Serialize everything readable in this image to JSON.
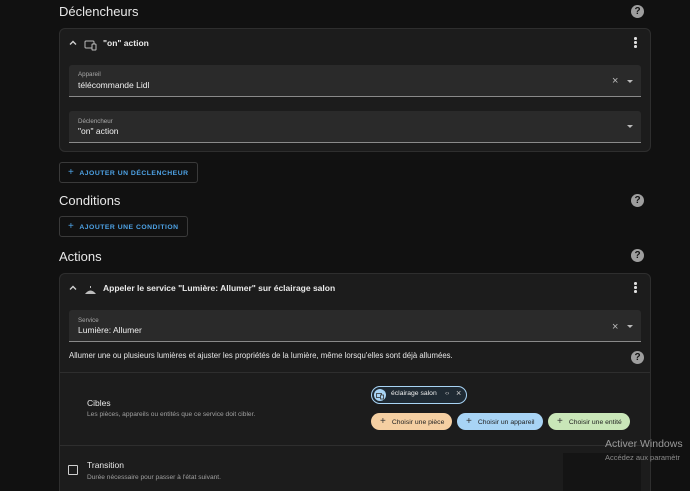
{
  "triggers": {
    "title": "Déclencheurs",
    "card_title": "\"on\" action",
    "device_field": {
      "label": "Appareil",
      "value": "télécommande Lidl"
    },
    "trigger_field": {
      "label": "Déclencheur",
      "value": "\"on\" action"
    },
    "add_label": "AJOUTER UN DÉCLENCHEUR"
  },
  "conditions": {
    "title": "Conditions",
    "add_label": "AJOUTER UNE CONDITION"
  },
  "actions": {
    "title": "Actions",
    "card_title": "Appeler le service \"Lumière: Allumer\" sur éclairage salon",
    "service_field": {
      "label": "Service",
      "value": "Lumière: Allumer"
    },
    "description": "Allumer une ou plusieurs lumières et ajuster les propriétés de la lumière, même lorsqu'elles sont déjà allumées.",
    "targets": {
      "title": "Cibles",
      "subtitle": "Les pièces, appareils ou entités que ce service doit cibler.",
      "selected_chip": "éclairage salon",
      "choose_room": "Choisir une pièce",
      "choose_device": "Choisir un appareil",
      "choose_entity": "Choisir une entité"
    },
    "transition": {
      "title": "Transition",
      "subtitle": "Durée nécessaire pour passer à l'état suivant."
    }
  },
  "help_icon_glyph": "?",
  "plus_glyph": "+",
  "close_glyph": "×",
  "windows_watermark": {
    "line1": "Activer Windows",
    "line2": "Accédez aux paramètr"
  },
  "colors": {
    "accent": "#4ea3e6",
    "chip_room": "#f5cfa2",
    "chip_device": "#a8d4f5",
    "chip_entity": "#c9e6b8",
    "background": "#111111",
    "card": "#1c1c1c"
  }
}
